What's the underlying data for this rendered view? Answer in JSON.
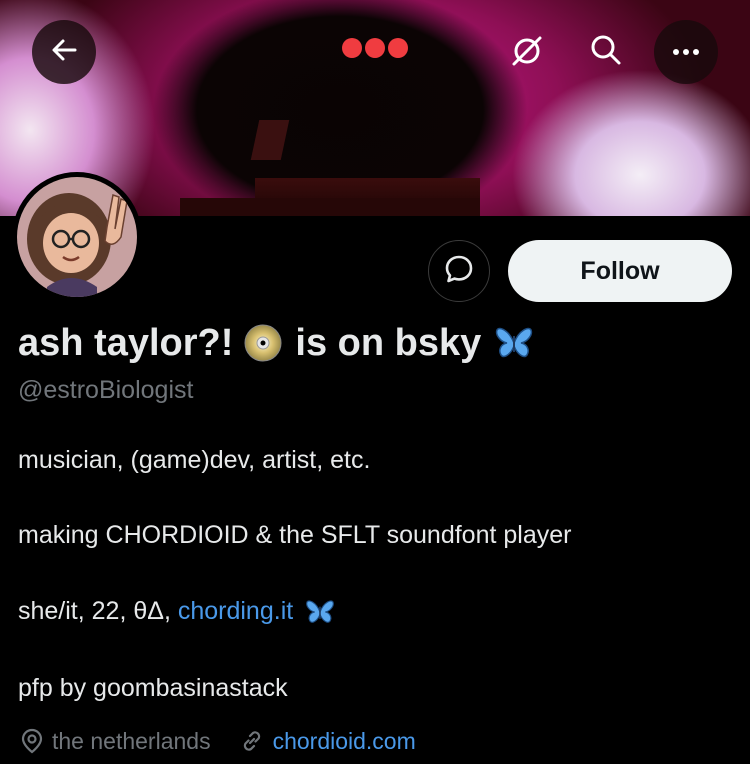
{
  "header": {
    "back_label": "Back",
    "more_label": "More"
  },
  "profile": {
    "display_name_part1": "ash taylor?!",
    "display_name_part2": "is on bsky",
    "handle": "@estroBiologist",
    "follow_label": "Follow",
    "bio": {
      "line1": "musician, (game)dev, artist, etc.",
      "line2": "making CHORDIOID & the SFLT soundfont player",
      "line3_prefix": "she/it, 22, θΔ, ",
      "line3_link": "chording.it",
      "line4": "pfp by goombasinastack"
    },
    "location": "the netherlands",
    "website": "chordioid.com"
  },
  "colors": {
    "accent_link": "#4a99e9",
    "follow_bg": "#eff3f4",
    "muted_text": "#71767b",
    "dots_red": "#f03c40"
  },
  "icons": [
    "back-arrow-icon",
    "grok-icon",
    "search-icon",
    "more-icon",
    "message-icon",
    "location-icon",
    "link-icon",
    "disc-emoji",
    "butterfly-emoji"
  ]
}
